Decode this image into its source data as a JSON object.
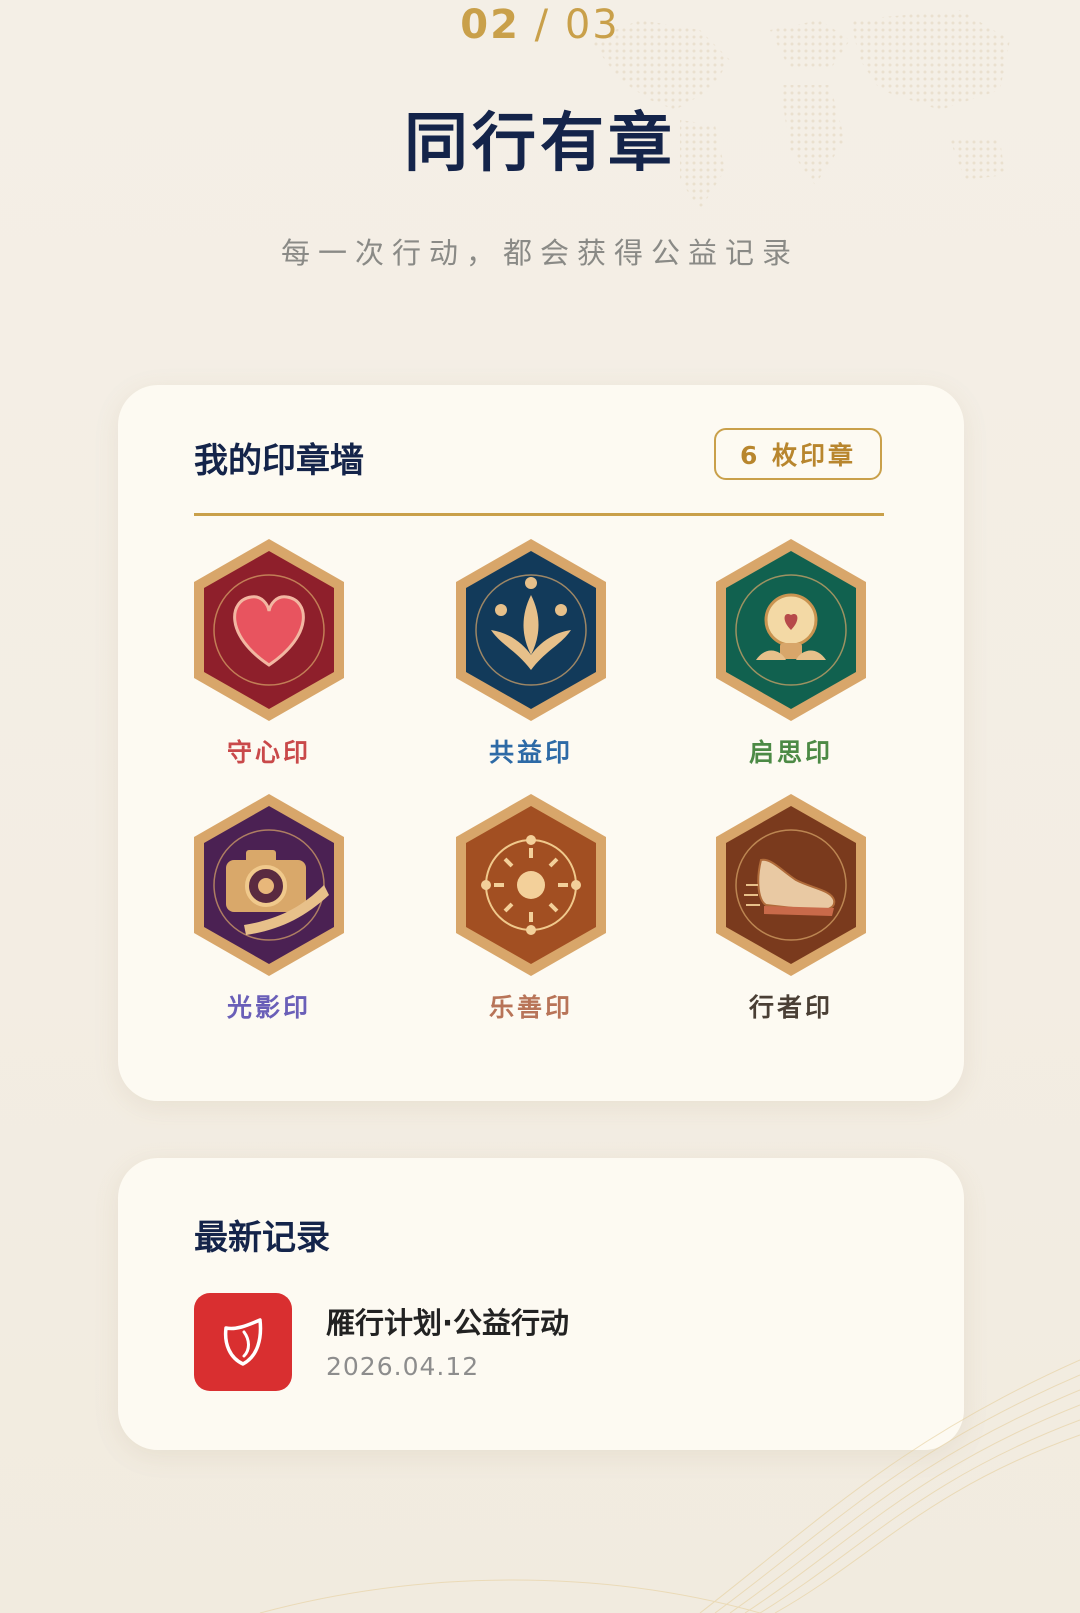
{
  "pager": {
    "current": "02",
    "separator": "/",
    "total": "03"
  },
  "title": "同行有章",
  "subtitle": "每一次行动，都会获得公益记录",
  "stamp_wall": {
    "title": "我的印章墙",
    "count_badge": "6 枚印章",
    "badges": [
      {
        "label": "守心印",
        "icon": "heart-icon",
        "bg": "#8e1f2b",
        "label_color": "#c9494a"
      },
      {
        "label": "共益印",
        "icon": "leaf-sprout-icon",
        "bg": "#123a5a",
        "label_color": "#2d6aa6"
      },
      {
        "label": "启思印",
        "icon": "lightbulb-icon",
        "bg": "#11614f",
        "label_color": "#4c8a45"
      },
      {
        "label": "光影印",
        "icon": "camera-icon",
        "bg": "#4b2153",
        "label_color": "#6a5fb8"
      },
      {
        "label": "乐善印",
        "icon": "sun-icon",
        "bg": "#a24f22",
        "label_color": "#b87458"
      },
      {
        "label": "行者印",
        "icon": "running-shoe-icon",
        "bg": "#7a3a1d",
        "label_color": "#4a3f35"
      }
    ]
  },
  "latest_record": {
    "title": "最新记录",
    "items": [
      {
        "name": "雁行计划·公益行动",
        "date": "2026.04.12",
        "icon": "shield-icon",
        "color": "#d92f30"
      }
    ]
  }
}
